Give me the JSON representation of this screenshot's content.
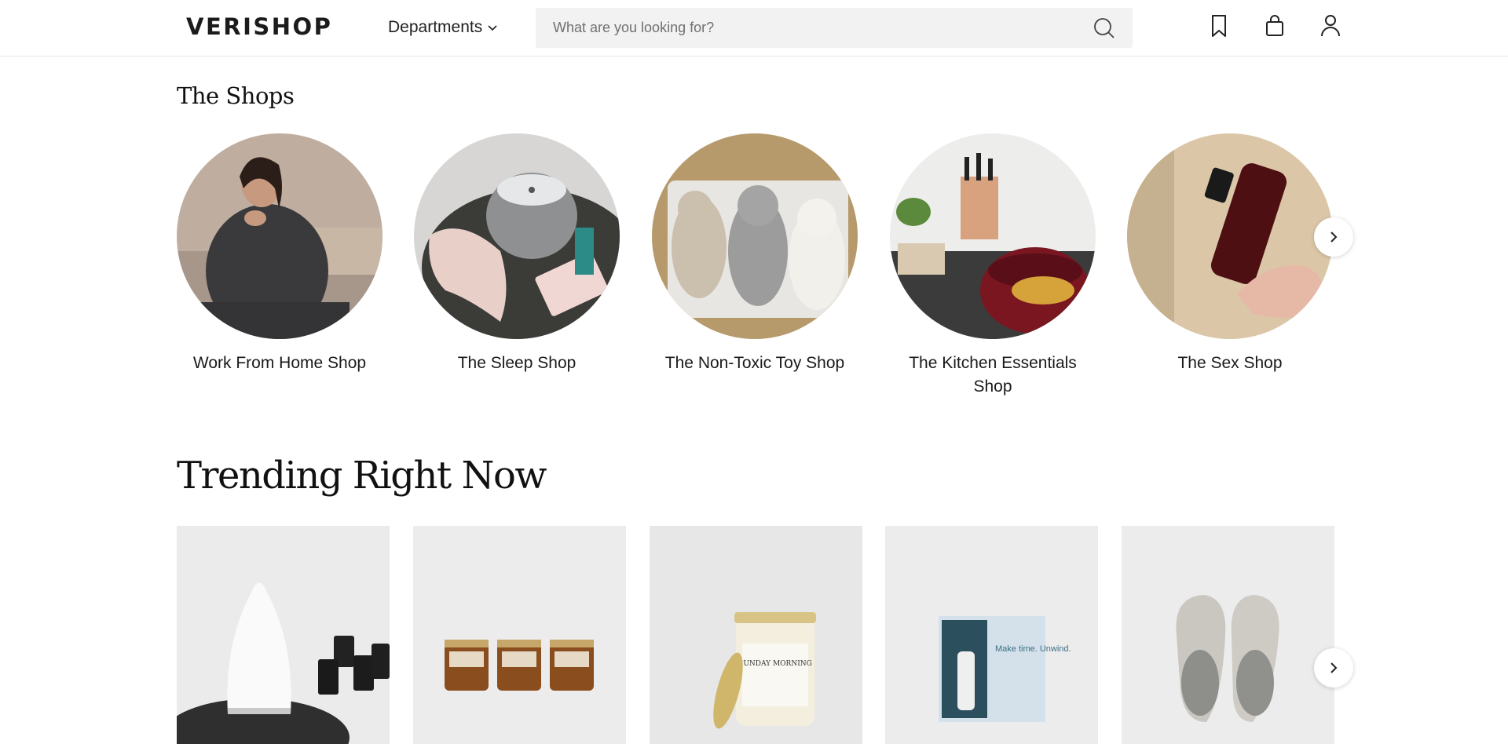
{
  "header": {
    "logo": "VERISHOP",
    "departments_label": "Departments",
    "search_placeholder": "What are you looking for?"
  },
  "shops": {
    "title": "The Shops",
    "items": [
      {
        "label": "Work From Home Shop"
      },
      {
        "label": "The Sleep Shop"
      },
      {
        "label": "The Non-Toxic Toy Shop"
      },
      {
        "label": "The Kitchen Essentials Shop"
      },
      {
        "label": "The Sex Shop"
      }
    ]
  },
  "trending": {
    "title": "Trending Right Now",
    "products": [
      {
        "image": "diffuser-with-essential-oils"
      },
      {
        "image": "three-amber-candles"
      },
      {
        "image": "sunday-morning-candle",
        "label_text": "SUNDAY MORNING"
      },
      {
        "image": "boxed-diffuser",
        "label_text": "Make time. Unwind."
      },
      {
        "image": "felt-slippers"
      }
    ]
  },
  "icons": [
    "search-icon",
    "bookmark-icon",
    "shopping-bag-icon",
    "user-icon",
    "chevron-down-icon",
    "chevron-right-icon"
  ]
}
